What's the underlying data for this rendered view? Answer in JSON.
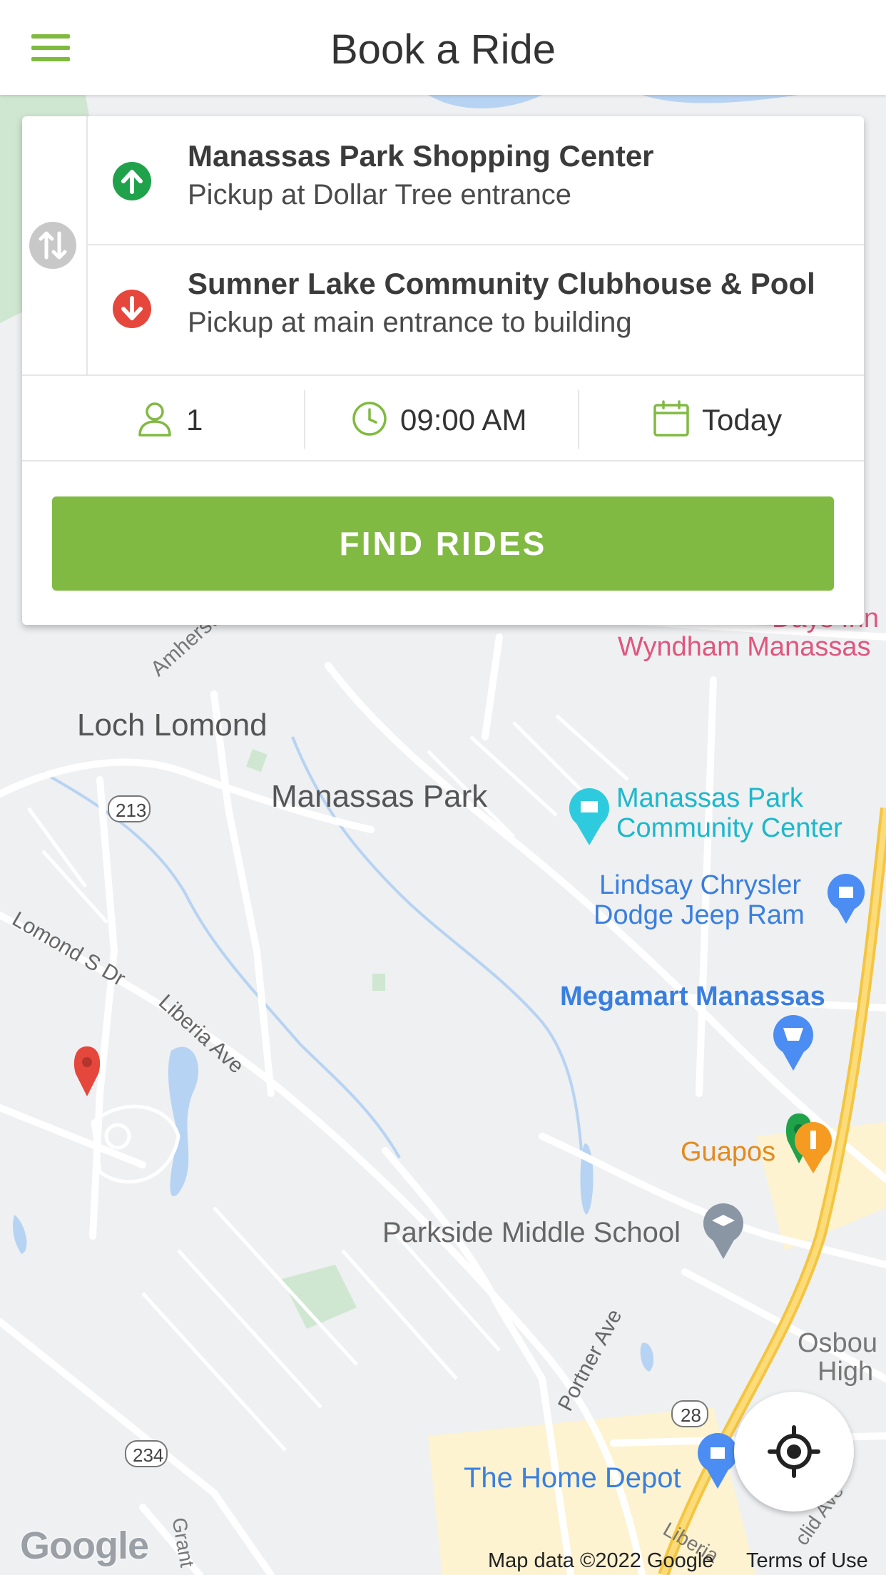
{
  "header": {
    "title": "Book a Ride"
  },
  "pickup": {
    "name": "Manassas Park Shopping Center",
    "detail": "Pickup at Dollar Tree entrance"
  },
  "dropoff": {
    "name": "Sumner Lake Community Clubhouse & Pool",
    "detail": "Pickup at main entrance to building"
  },
  "options": {
    "passengers": "1",
    "time": "09:00 AM",
    "date": "Today"
  },
  "find_button": "FIND RIDES",
  "map": {
    "labels": {
      "amherst": "Amherst Dr",
      "loch_lomond": "Loch Lomond",
      "manassas_park": "Manassas Park",
      "community_center_1": "Manassas Park",
      "community_center_2": "Community Center",
      "lindsay_1": "Lindsay Chrysler",
      "lindsay_2": "Dodge Jeep Ram",
      "megamart": "Megamart Manassas",
      "guapos": "Guapos",
      "parkside": "Parkside Middle School",
      "lomond_s": "Lomond S Dr",
      "liberia": "Liberia Ave",
      "portner": "Portner Ave",
      "home_depot": "The Home Depot",
      "osbou_1": "Osbou",
      "osbou_2": "High",
      "days_inn_1": "Days Inn by",
      "days_inn_2": "Wyndham Manassas",
      "route_213": "213",
      "route_234": "234",
      "route_28": "28",
      "grant": "Grant",
      "liberia_2": "Liberia",
      "euclid": "clid Ave"
    },
    "google_logo": "Google",
    "map_data": "Map data ©2022 Google",
    "terms": "Terms of Use"
  },
  "colors": {
    "accent": "#81ba42",
    "pickup": "#1fa24a",
    "dropoff": "#e5473c"
  }
}
